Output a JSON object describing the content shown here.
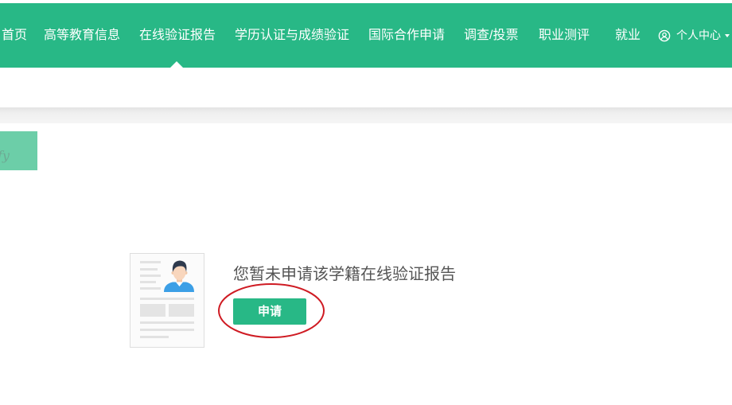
{
  "nav": {
    "items": [
      {
        "label": "首页",
        "active": false
      },
      {
        "label": "高等教育信息",
        "active": false
      },
      {
        "label": "在线验证报告",
        "active": true
      },
      {
        "label": "学历认证与成绩验证",
        "active": false
      },
      {
        "label": "国际合作申请",
        "active": false
      },
      {
        "label": "调查/投票",
        "active": false
      },
      {
        "label": "职业测评",
        "active": false
      },
      {
        "label": "就业",
        "active": false
      }
    ],
    "user_center": {
      "label": "个人中心",
      "icon": "user-circle-icon",
      "caret_icon": "caret-down-icon"
    }
  },
  "banner": {
    "text": "fy"
  },
  "empty_state": {
    "illustration": "resume-document-icon",
    "message": "您暂未申请该学籍在线验证报告",
    "apply_label": "申请"
  },
  "colors": {
    "brand_green": "#28b886",
    "badge_green": "#6ccea8",
    "annotation_red": "#cf1b23"
  }
}
